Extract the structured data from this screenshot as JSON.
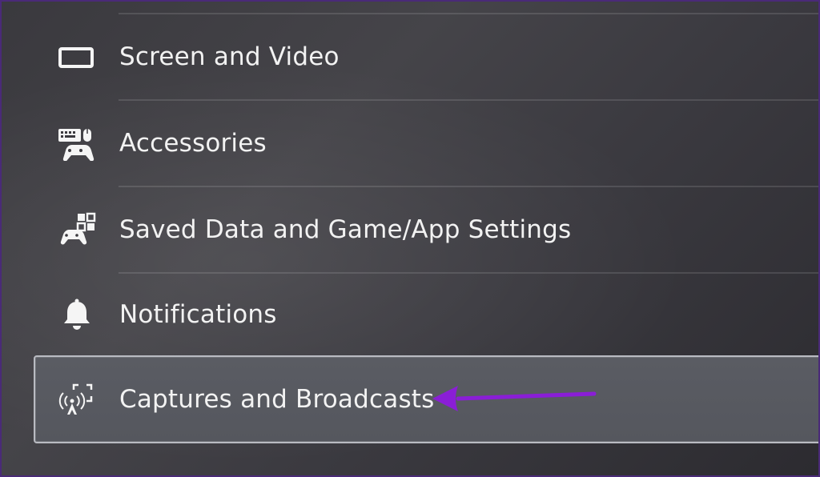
{
  "settings_menu": {
    "items": [
      {
        "label": "Screen and Video",
        "icon": "screen-icon"
      },
      {
        "label": "Accessories",
        "icon": "accessories-icon"
      },
      {
        "label": "Saved Data and Game/App Settings",
        "icon": "saved-data-icon"
      },
      {
        "label": "Notifications",
        "icon": "bell-icon"
      },
      {
        "label": "Captures and Broadcasts",
        "icon": "broadcast-icon",
        "selected": true
      }
    ]
  },
  "annotation": {
    "arrow_color": "#8a1ed6"
  },
  "colors": {
    "background": "#3a393e",
    "text": "#f2f2f2",
    "selection": "#58595f",
    "border_accent": "#4a2a78"
  }
}
